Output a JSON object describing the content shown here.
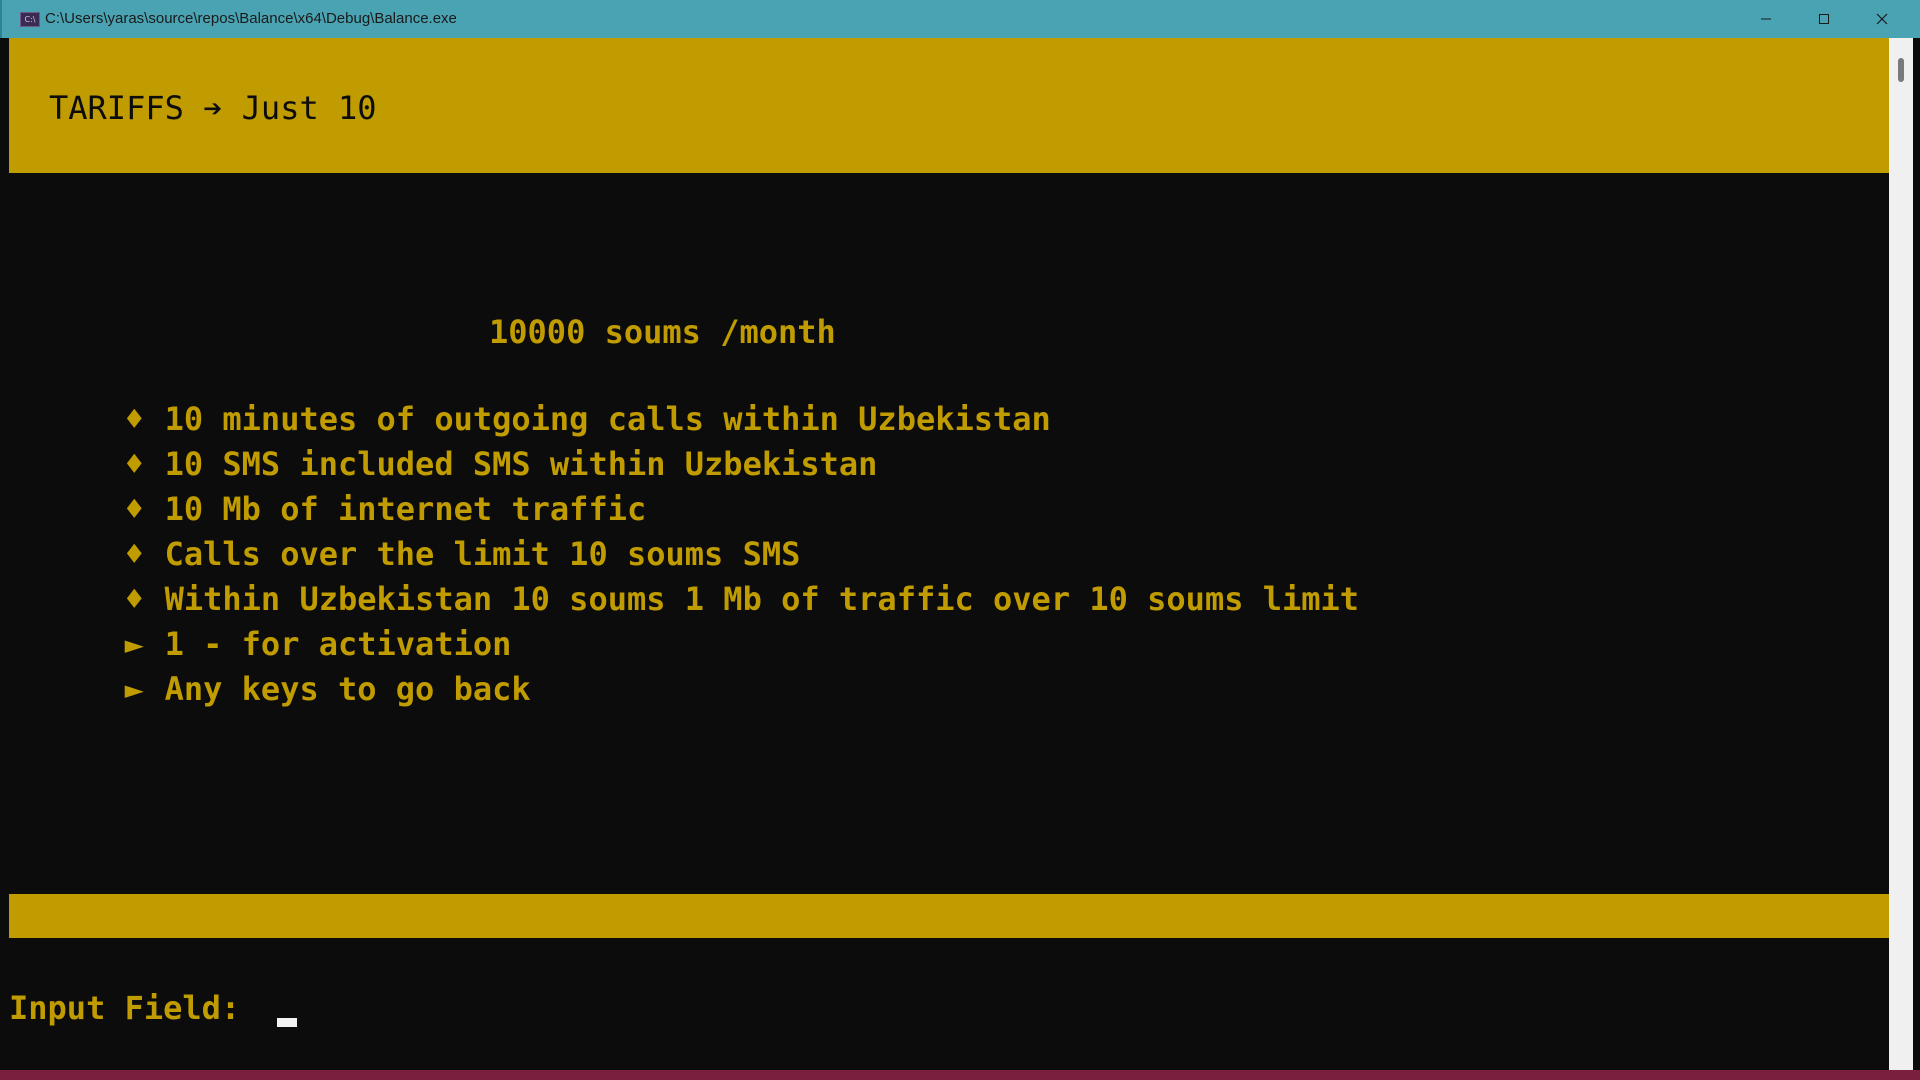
{
  "window": {
    "title": "C:\\Users\\yaras\\source\\repos\\Balance\\x64\\Debug\\Balance.exe",
    "icon": "console-app-icon",
    "icon_text": "C:\\",
    "minimize_icon": "minimize-icon",
    "maximize_icon": "maximize-icon",
    "close_icon": "close-icon"
  },
  "colors": {
    "accent": "#c19c00",
    "background": "#0c0c0c",
    "titlebar": "#4aa3b3",
    "cursor": "#f2f2f2"
  },
  "header": {
    "title": "TARIFFS ➔ Just 10"
  },
  "tariff": {
    "price": "10000 soums /month",
    "features": [
      {
        "marker": "♦",
        "text": "10 minutes of outgoing calls within Uzbekistan"
      },
      {
        "marker": "♦",
        "text": "10 SMS included SMS within Uzbekistan"
      },
      {
        "marker": "♦",
        "text": "10 Mb of internet traffic"
      },
      {
        "marker": "♦",
        "text": "Calls over the limit 10 soums SMS"
      },
      {
        "marker": "♦",
        "text": "Within Uzbekistan 10 soums 1 Mb of traffic over 10 soums limit"
      }
    ],
    "options": [
      {
        "marker": "►",
        "text": "1 - for activation"
      },
      {
        "marker": "►",
        "text": "Any keys to go back"
      }
    ]
  },
  "input": {
    "label": "Input Field:"
  }
}
